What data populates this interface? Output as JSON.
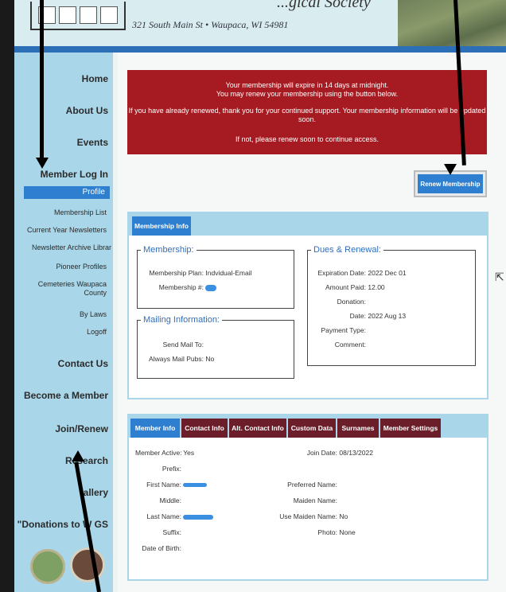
{
  "header": {
    "org_name": "...gical Society",
    "address": "321 South Main St • Waupaca, WI 54981"
  },
  "sidebar": {
    "items": [
      {
        "label": "Home"
      },
      {
        "label": "About Us"
      },
      {
        "label": "Events"
      },
      {
        "label": "Member Log In"
      }
    ],
    "sub_items": [
      {
        "label": "Profile",
        "active": true
      },
      {
        "label": "Membership List"
      },
      {
        "label": "Current Year Newsletters"
      },
      {
        "label": "Newsletter Archive Librar"
      },
      {
        "label": "Pioneer Profiles"
      },
      {
        "label": "Cemeteries Waupaca County"
      },
      {
        "label": "By Laws"
      },
      {
        "label": "Logoff"
      }
    ],
    "lower_items": [
      {
        "label": "Contact Us"
      },
      {
        "label": "Become a Member"
      },
      {
        "label": "Join/Renew"
      },
      {
        "label": "Research"
      },
      {
        "label": "allery"
      },
      {
        "label": "\"Donations to W GS"
      }
    ]
  },
  "alert": {
    "line1": "Your membership will expire in 14 days at midnight.",
    "line2": "You may renew your membership using the button below.",
    "line3": "If you have already renewed, thank you for your continued support. Your membership information will be updated soon.",
    "line4": "If not, please renew soon to continue access."
  },
  "renew_button": "Renew Membership",
  "membership_info": {
    "tab": "Membership Info",
    "membership": {
      "legend": "Membership:",
      "plan_label": "Membership Plan:",
      "plan_value": "Indvidual-Email",
      "number_label": "Membership #:"
    },
    "mailing": {
      "legend": "Mailing Information:",
      "send_mail_label": "Send Mail To:",
      "send_mail_value": "",
      "always_mail_label": "Always Mail Pubs:",
      "always_mail_value": "No"
    },
    "dues": {
      "legend": "Dues & Renewal:",
      "expiration_label": "Expiration Date:",
      "expiration_value": "2022 Dec 01",
      "amount_label": "Amount Paid:",
      "amount_value": "12.00",
      "donation_label": "Donation:",
      "donation_value": "",
      "date_label": "Date:",
      "date_value": "2022 Aug 13",
      "payment_label": "Payment Type:",
      "payment_value": "",
      "comment_label": "Comment:",
      "comment_value": ""
    }
  },
  "member_tabs": [
    "Member Info",
    "Contact Info",
    "Alt. Contact Info",
    "Custom Data",
    "Surnames",
    "Member Settings"
  ],
  "member_info": {
    "left": [
      {
        "label": "Member Active:",
        "value": "Yes"
      },
      {
        "label": "Prefix:",
        "value": ""
      },
      {
        "label": "First Name:",
        "value": ""
      },
      {
        "label": "Middle:",
        "value": ""
      },
      {
        "label": "Last Name:",
        "value": ""
      },
      {
        "label": "Suffix:",
        "value": ""
      },
      {
        "label": "Date of Birth:",
        "value": ""
      }
    ],
    "right": [
      {
        "label": "Join Date:",
        "value": "08/13/2022"
      },
      {
        "label": "Preferred Name:",
        "value": ""
      },
      {
        "label": "Maiden Name:",
        "value": ""
      },
      {
        "label": "Use Maiden Name:",
        "value": "No"
      },
      {
        "label": "Photo:",
        "value": "None"
      }
    ]
  },
  "colors": {
    "sidebar_bg": "#a9d6e8",
    "alert_bg": "#a61b22",
    "accent_blue": "#2f7fd0",
    "tab_maroon": "#6b1e2a"
  }
}
